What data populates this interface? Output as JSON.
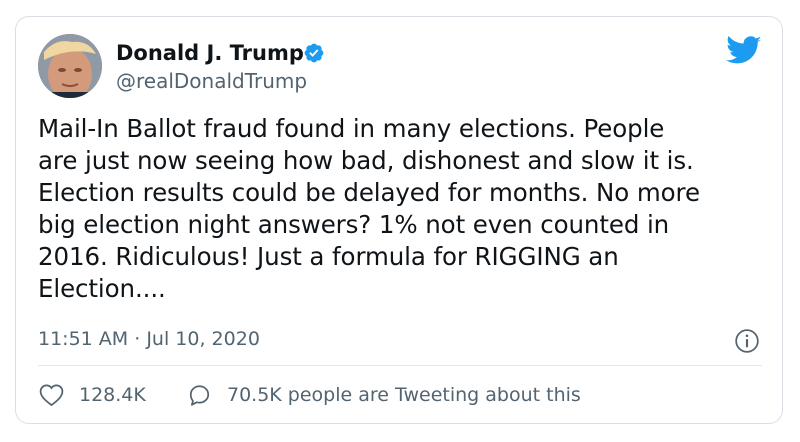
{
  "tweet": {
    "author_name": "Donald J. Trump",
    "handle": "@realDonaldTrump",
    "text": "Mail-In Ballot fraud found in many elections. People\nare just now seeing how bad, dishonest and slow it is.\nElection results could be delayed for months. No more\nbig election night answers? 1% not even counted in\n2016. Ridiculous! Just a formula for RIGGING an\nElection....",
    "time": "11:51 AM",
    "separator": "·",
    "date": "Jul 10, 2020",
    "likes": "128.4K",
    "tweeting_text": "70.5K people are Tweeting about this"
  },
  "icons": {
    "brand": "twitter-bird-icon",
    "verified": "verified-badge-icon",
    "info": "info-icon",
    "like": "heart-icon",
    "reply": "speech-bubble-icon"
  },
  "colors": {
    "brand_blue": "#1d9bf0",
    "text_primary": "#0f1419",
    "text_secondary": "#536471",
    "border": "#d9dfe4"
  }
}
